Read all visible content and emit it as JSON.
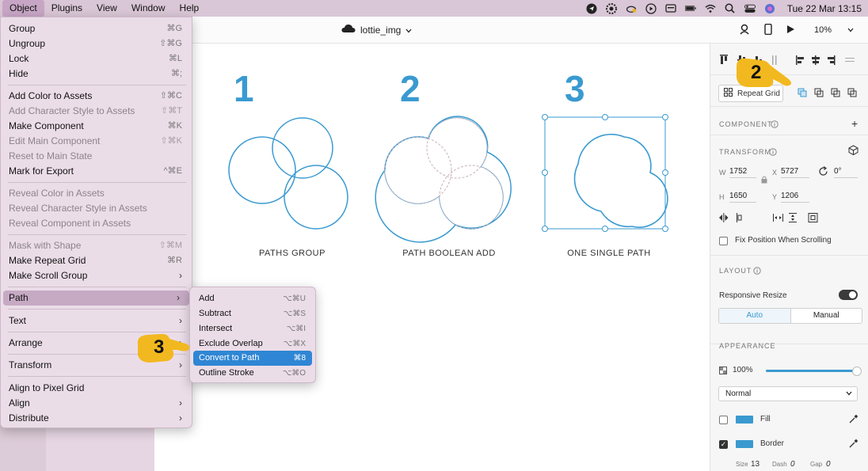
{
  "menubar": {
    "items": [
      "Object",
      "Plugins",
      "View",
      "Window",
      "Help"
    ],
    "clock": "Tue 22 Mar  13:15"
  },
  "toolbar": {
    "doc_title": "lottie_img",
    "zoom": "10%"
  },
  "canvas": {
    "examples": [
      {
        "number": "1",
        "caption": "PATHS GROUP"
      },
      {
        "number": "2",
        "caption": "PATH BOOLEAN ADD"
      },
      {
        "number": "3",
        "caption": "ONE SINGLE PATH"
      }
    ]
  },
  "object_menu": {
    "items": [
      {
        "label": "Group",
        "shortcut": "⌘G"
      },
      {
        "label": "Ungroup",
        "shortcut": "⇧⌘G"
      },
      {
        "label": "Lock",
        "shortcut": "⌘L"
      },
      {
        "label": "Hide",
        "shortcut": "⌘;"
      },
      {
        "label": "Add Color to Assets",
        "shortcut": "⇧⌘C"
      },
      {
        "label": "Add Character Style to Assets",
        "shortcut": "⇧⌘T"
      },
      {
        "label": "Make Component",
        "shortcut": "⌘K"
      },
      {
        "label": "Edit Main Component",
        "shortcut": "⇧⌘K"
      },
      {
        "label": "Reset to Main State",
        "shortcut": ""
      },
      {
        "label": "Mark for Export",
        "shortcut": "^⌘E"
      },
      {
        "label": "Reveal Color in Assets",
        "shortcut": ""
      },
      {
        "label": "Reveal Character Style in Assets",
        "shortcut": ""
      },
      {
        "label": "Reveal Component in Assets",
        "shortcut": ""
      },
      {
        "label": "Mask with Shape",
        "shortcut": "⇧⌘M"
      },
      {
        "label": "Make Repeat Grid",
        "shortcut": "⌘R"
      },
      {
        "label": "Make Scroll Group",
        "shortcut": ""
      },
      {
        "label": "Path",
        "shortcut": ""
      },
      {
        "label": "Text",
        "shortcut": ""
      },
      {
        "label": "Arrange",
        "shortcut": ""
      },
      {
        "label": "Transform",
        "shortcut": ""
      },
      {
        "label": "Align to Pixel Grid",
        "shortcut": ""
      },
      {
        "label": "Align",
        "shortcut": ""
      },
      {
        "label": "Distribute",
        "shortcut": ""
      }
    ]
  },
  "path_submenu": {
    "items": [
      {
        "label": "Add",
        "shortcut": "⌥⌘U"
      },
      {
        "label": "Subtract",
        "shortcut": "⌥⌘S"
      },
      {
        "label": "Intersect",
        "shortcut": "⌥⌘I"
      },
      {
        "label": "Exclude Overlap",
        "shortcut": "⌥⌘X"
      },
      {
        "label": "Convert to Path",
        "shortcut": "⌘8"
      },
      {
        "label": "Outline Stroke",
        "shortcut": "⌥⌘O"
      }
    ],
    "selected": "Convert to Path"
  },
  "callouts": {
    "step2": "2",
    "step3": "3"
  },
  "panel": {
    "repeat_grid": "Repeat Grid",
    "component_label": "COMPONENT",
    "transform_label": "TRANSFORM",
    "w_label": "W",
    "w_value": "1752",
    "x_label": "X",
    "x_value": "5727",
    "rotation_value": "0°",
    "h_label": "H",
    "h_value": "1650",
    "y_label": "Y",
    "y_value": "1206",
    "fix_position": "Fix Position When Scrolling",
    "layout_label": "LAYOUT",
    "responsive_resize": "Responsive Resize",
    "auto": "Auto",
    "manual": "Manual",
    "appearance_label": "APPEARANCE",
    "opacity": "100%",
    "blend_mode": "Normal",
    "fill_label": "Fill",
    "border_label": "Border",
    "size_label": "Size",
    "size_value": "13",
    "dash_label": "Dash",
    "dash_value": "0",
    "gap_label": "Gap",
    "gap_value": "0"
  },
  "colors": {
    "accent": "#3a9ad0",
    "callout": "#f2b81f",
    "menu_bg": "#ebdde8",
    "selection": "#2f86d4"
  }
}
